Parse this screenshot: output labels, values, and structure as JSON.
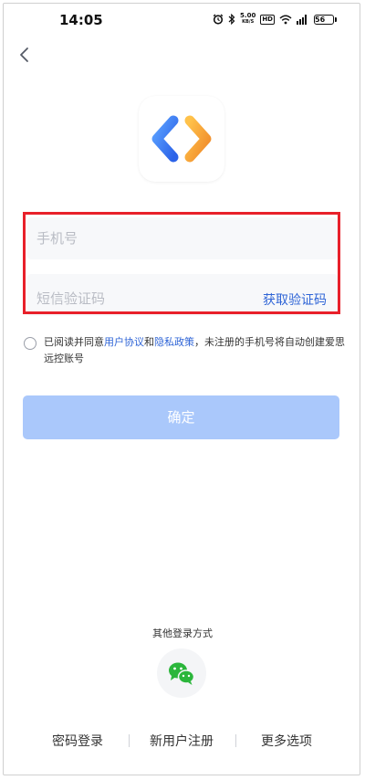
{
  "status_bar": {
    "time": "14:05",
    "speed_value": "5.00",
    "speed_unit": "KB/S",
    "hd": "HD",
    "battery": "56",
    "icons": [
      "alarm-icon",
      "bluetooth-icon",
      "wifi-icon",
      "signal-icon",
      "battery-icon"
    ]
  },
  "nav": {
    "back_icon": "chevron-left-icon"
  },
  "logo": {
    "icon": "app-logo-icon",
    "colors": {
      "blue": "#3d7cf2",
      "orange": "#f7a23c"
    }
  },
  "form": {
    "phone_placeholder": "手机号",
    "phone_value": "",
    "code_placeholder": "短信验证码",
    "code_value": "",
    "get_code_label": "获取验证码",
    "highlight_color": "#e8202a"
  },
  "agreement": {
    "checked": false,
    "prefix": "已阅读并同意",
    "user_agreement": "用户协议",
    "and": "和",
    "privacy_policy": "隐私政策",
    "suffix": "，未注册的手机号将自动创建爱思远控账号"
  },
  "confirm": {
    "label": "确定",
    "color": "#aac8fb"
  },
  "other_login": {
    "label": "其他登录方式",
    "wechat_icon": "wechat-icon",
    "wechat_color": "#2bb63b"
  },
  "bottom_links": {
    "password_login": "密码登录",
    "register": "新用户注册",
    "more_options": "更多选项"
  }
}
